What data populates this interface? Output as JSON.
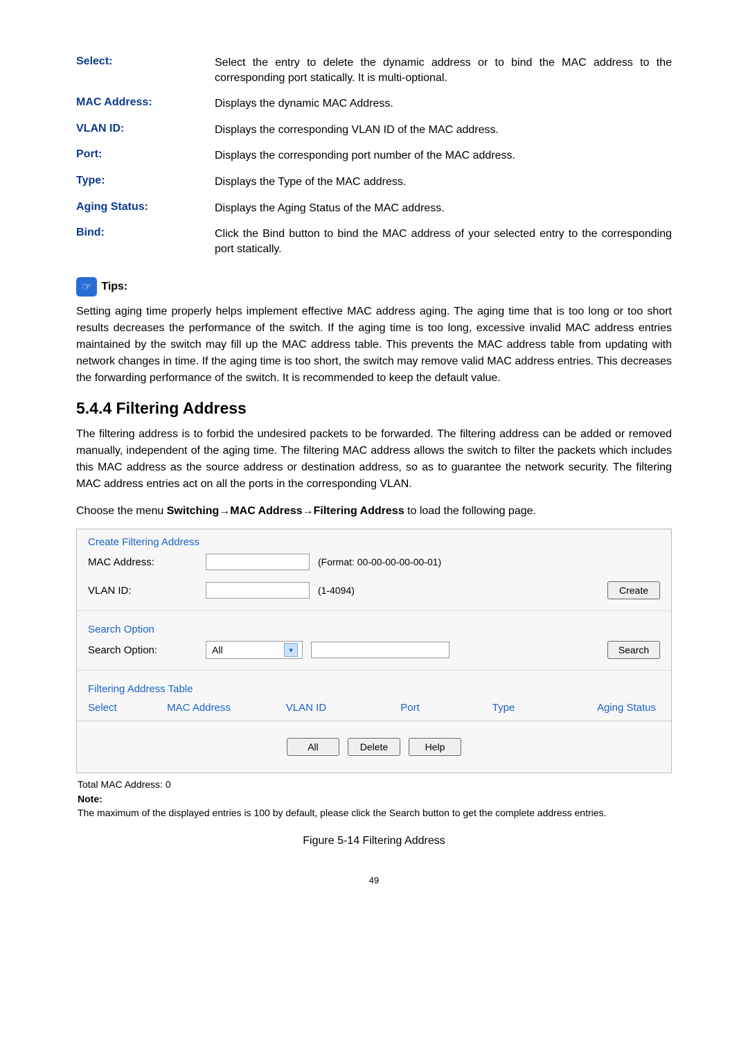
{
  "definitions": [
    {
      "term": "Select:",
      "desc": "Select the entry to delete the dynamic address or to bind the MAC address to the corresponding port statically. It is multi-optional."
    },
    {
      "term": "MAC Address:",
      "desc": "Displays the dynamic MAC Address."
    },
    {
      "term": "VLAN ID:",
      "desc": "Displays the corresponding VLAN ID of the MAC address."
    },
    {
      "term": "Port:",
      "desc": "Displays the corresponding port number of the MAC address."
    },
    {
      "term": "Type:",
      "desc": "Displays the Type of the MAC address."
    },
    {
      "term": "Aging Status:",
      "desc": "Displays the Aging Status of the MAC address."
    },
    {
      "term": "Bind:",
      "desc": "Click the Bind button to bind the MAC address of your selected entry to the corresponding port statically."
    }
  ],
  "tips": {
    "icon": "☞",
    "label": "Tips:",
    "text": "Setting aging time properly helps implement effective MAC address aging. The aging time that is too long or too short results decreases the performance of the switch. If the aging time is too long, excessive invalid MAC address entries maintained by the switch may fill up the MAC address table. This prevents the MAC address table from updating with network changes in time. If the aging time is too short, the switch may remove valid MAC address entries. This decreases the forwarding performance of the switch. It is recommended to keep the default value."
  },
  "section": {
    "title": "5.4.4 Filtering Address",
    "intro": "The filtering address is to forbid the undesired packets to be forwarded. The filtering address can be added or removed manually, independent of the aging time. The filtering MAC address allows the switch to filter the packets which includes this MAC address as the source address or destination address, so as to guarantee the network security. The filtering MAC address entries act on all the ports in the corresponding VLAN.",
    "menu_prefix": "Choose the menu ",
    "menu_bold": "Switching→MAC Address→Filtering Address",
    "menu_suffix": " to load the following page."
  },
  "ui": {
    "create": {
      "title": "Create Filtering Address",
      "mac_label": "MAC Address:",
      "mac_hint": "(Format: 00-00-00-00-00-01)",
      "vlan_label": "VLAN ID:",
      "vlan_hint": "(1-4094)",
      "btn": "Create"
    },
    "search": {
      "title": "Search Option",
      "label": "Search Option:",
      "selected": "All",
      "btn": "Search"
    },
    "table": {
      "title": "Filtering Address Table",
      "cols": {
        "select": "Select",
        "mac": "MAC Address",
        "vlan": "VLAN ID",
        "port": "Port",
        "type": "Type",
        "aging": "Aging Status"
      },
      "btn_all": "All",
      "btn_delete": "Delete",
      "btn_help": "Help"
    },
    "footer": {
      "total": "Total MAC Address: 0",
      "note_label": "Note:",
      "note_text": "The maximum of the displayed entries is 100 by default, please click the Search button to get the complete address entries."
    }
  },
  "figure_caption": "Figure 5-14 Filtering Address",
  "page_number": "49"
}
